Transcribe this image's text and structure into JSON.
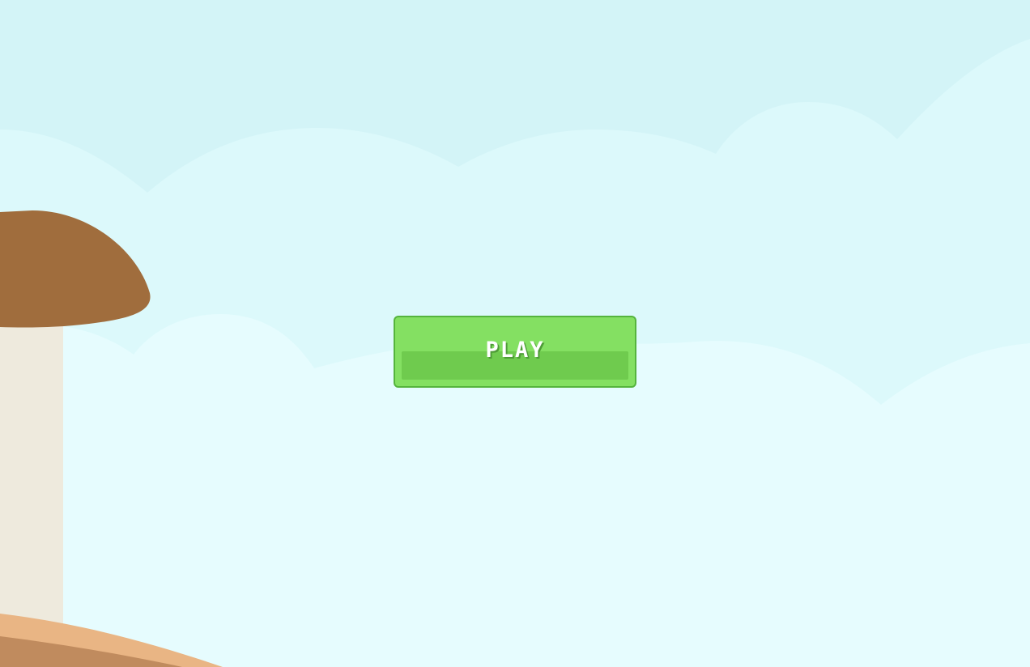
{
  "game": {
    "play_button_label": "PLAY"
  },
  "colors": {
    "sky_top": "#d3f4f7",
    "sky_mid": "#dcf9fb",
    "sky_bottom": "#e6fcfe",
    "mushroom_cap": "#a06d3d",
    "mushroom_stem": "#eeeadd",
    "ground": "#e9b584",
    "ground_dark": "#c08b5e",
    "button_face": "#84e062",
    "button_shade": "#6fcb4e",
    "button_border": "#55b43d",
    "button_text": "#ffffff"
  }
}
